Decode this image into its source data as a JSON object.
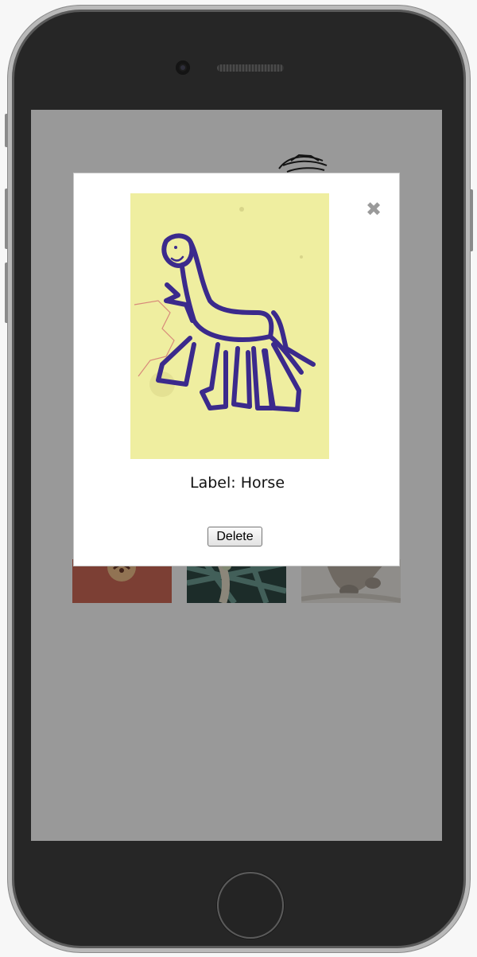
{
  "modal": {
    "image_alt": "Child's purple marker drawing of a horse on yellow paper",
    "label_prefix": "Label:",
    "label_value": "Horse",
    "delete_label": "Delete",
    "close_icon": "✖"
  },
  "colors": {
    "overlay": "rgba(0,0,0,0.4)",
    "modal_bg": "#ffffff",
    "paper": "#efeea0",
    "ink": "#3b2a8c",
    "phone_body": "#262626"
  },
  "background_thumbnails": [
    "thumbnail-1",
    "thumbnail-2",
    "thumbnail-3"
  ]
}
